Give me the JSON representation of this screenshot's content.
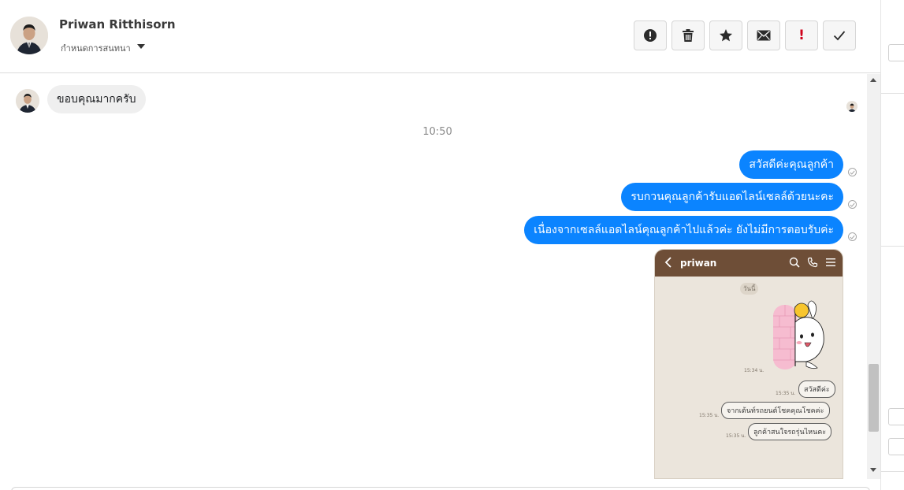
{
  "header": {
    "contact_name": "Priwan Ritthisorn",
    "conversation_label": "กำหนดการสนทนา"
  },
  "toolbar": {
    "important_glyph": "!"
  },
  "messages": {
    "incoming_1": "ขอบคุณมากครับ",
    "time_separator": "10:50",
    "outgoing_1": "สวัสดีค่ะคุณลูกค้า",
    "outgoing_2": "รบกวนคุณลูกค้ารับแอดไลน์เซลล์ด้วยนะคะ",
    "outgoing_3": "เนื่องจากเซลล์แอดไลน์คุณลูกค้าไปแล้วค่ะ ยังไม่มีการตอบรับค่ะ"
  },
  "attachment": {
    "title": "priwan",
    "day_label": "วันนี้",
    "time_1": "15:34 น.",
    "msg_1": "สวัสดีค่ะ",
    "time_2": "15:35 น.",
    "msg_2": "จากเต้นท์รถยนต์โชคคุณโชคค่ะ",
    "time_3": "15:35 น.",
    "msg_3": "ลูกค้าสนใจรถรุ่นไหนคะ",
    "time_4": "15:35 น."
  },
  "colors": {
    "outgoing_bubble": "#0b84ff",
    "incoming_bubble": "#efefef",
    "attachment_bar": "#6e4e37"
  },
  "icons": {
    "alert": "alert-circle-icon",
    "trash": "trash-icon",
    "star": "star-icon",
    "mail": "envelope-icon",
    "done": "check-icon"
  }
}
